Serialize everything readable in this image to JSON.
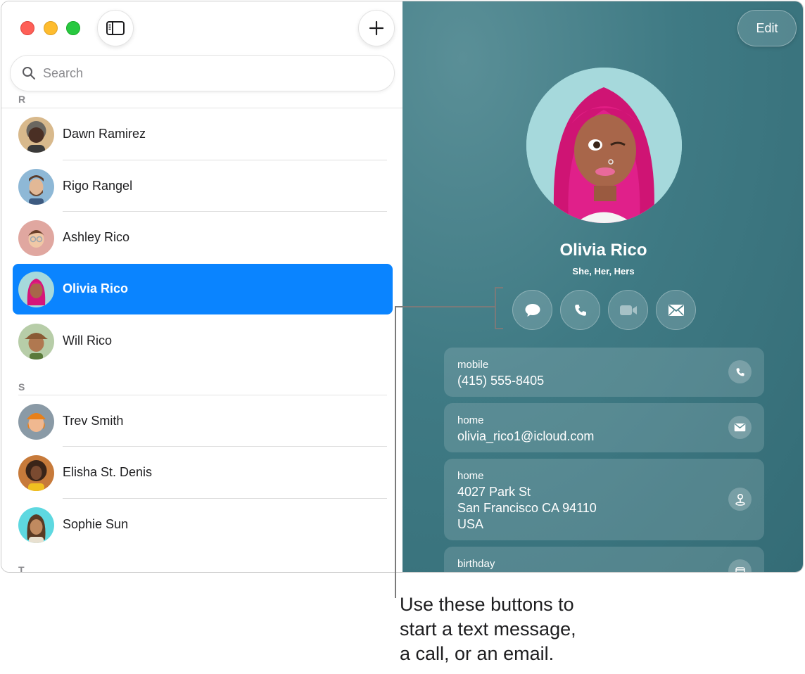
{
  "sidebar": {
    "search": {
      "placeholder": "Search"
    },
    "sections": [
      {
        "letter": "R"
      },
      {
        "letter": "S"
      },
      {
        "letter": "T"
      }
    ],
    "contacts": [
      {
        "name": "Dawn Ramirez"
      },
      {
        "name": "Rigo Rangel"
      },
      {
        "name": "Ashley Rico"
      },
      {
        "name": "Olivia Rico",
        "selected": true
      },
      {
        "name": "Will Rico"
      },
      {
        "name": "Trev Smith"
      },
      {
        "name": "Elisha St. Denis"
      },
      {
        "name": "Sophie Sun"
      }
    ]
  },
  "detail": {
    "edit_label": "Edit",
    "name": "Olivia Rico",
    "pronouns": "She, Her, Hers",
    "actions": [
      "message-icon",
      "phone-icon",
      "video-icon",
      "mail-icon"
    ],
    "fields": {
      "mobile": {
        "label": "mobile",
        "value": "(415) 555-8405"
      },
      "email": {
        "label": "home",
        "value": "olivia_rico1@icloud.com"
      },
      "address": {
        "label": "home",
        "line1": "4027 Park St",
        "line2": "San Francisco CA 94110",
        "line3": "USA"
      },
      "birthday": {
        "label": "birthday"
      }
    }
  },
  "callout": {
    "line1": "Use these buttons to",
    "line2": "start a text message,",
    "line3": "a call, or an email."
  },
  "colors": {
    "selection": "#0a84ff",
    "detail_background": "#3f7a84",
    "close": "#fe5f57",
    "minimize": "#febc2e",
    "zoom": "#28c840"
  }
}
